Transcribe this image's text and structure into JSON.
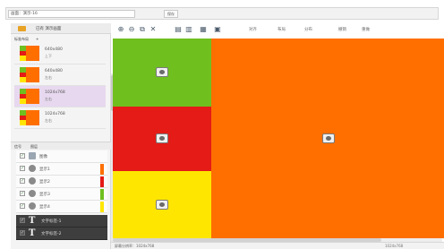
{
  "topbar": {
    "field_text": "画面：演示-16",
    "button_label": "保存"
  },
  "sidebar": {
    "header_label": "已有 演示画面",
    "subtabs": [
      "标准布局",
      "+"
    ],
    "layouts": [
      {
        "res": "640x480",
        "sub": "上下"
      },
      {
        "res": "640x480",
        "sub": "左右"
      },
      {
        "res": "1024x768",
        "sub": "左右"
      },
      {
        "res": "1024x768",
        "sub": "左右"
      }
    ],
    "lower_tabs": [
      "信号",
      "图层"
    ],
    "sources": [
      {
        "label": "图像",
        "color": ""
      },
      {
        "label": "显示1",
        "color": "#ff6f00"
      },
      {
        "label": "显示2",
        "color": "#e41b17"
      },
      {
        "label": "显示3",
        "color": "#6fbf1f"
      },
      {
        "label": "显示4",
        "color": "#ffe600"
      }
    ],
    "text_rows": [
      {
        "label": "文字标签-1"
      },
      {
        "label": "文字标签-2"
      }
    ]
  },
  "toolbar": {
    "icons": [
      "zoom-in-icon",
      "zoom-out-icon",
      "fit-icon",
      "close-icon",
      "align-left-icon",
      "align-center-icon",
      "align-right-icon",
      "grid-icon"
    ],
    "texts": [
      "对齐",
      "布局",
      "分布",
      "撤销",
      "重做"
    ]
  },
  "colors": {
    "green": "#6fbf1f",
    "red": "#e41b17",
    "yellow": "#ffe600",
    "orange": "#ff6f00"
  },
  "status": {
    "left": "屏幕分辨率：1024x768",
    "right": "1024x768"
  }
}
